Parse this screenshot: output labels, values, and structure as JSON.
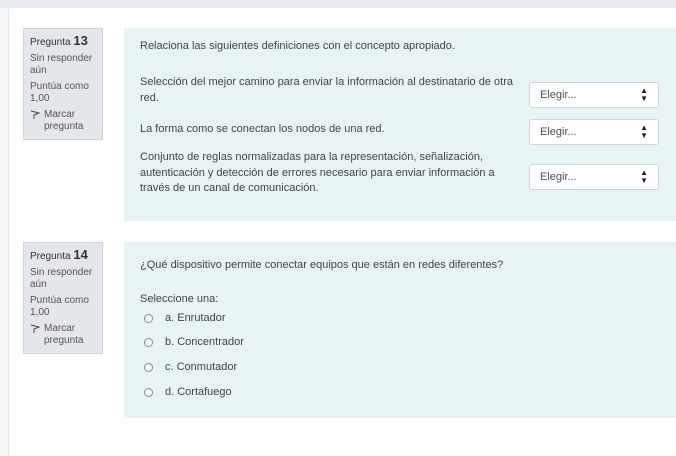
{
  "q13": {
    "label": "Pregunta",
    "number": "13",
    "status": "Sin responder aún",
    "grade": "Puntúa como 1,00",
    "flag": "Marcar pregunta",
    "prompt": "Relaciona las siguientes definiciones con el concepto apropiado.",
    "rows": [
      {
        "text": "Selección del mejor camino para enviar la información al destinatario de otra red.",
        "selected": "Elegir..."
      },
      {
        "text": "La forma como se conectan los nodos de una red.",
        "selected": "Elegir..."
      },
      {
        "text": "Conjunto de reglas normalizadas para la representación, señalización, autenticación y detección de errores necesario para enviar información a través de un canal de comunicación.",
        "selected": "Elegir..."
      }
    ]
  },
  "q14": {
    "label": "Pregunta",
    "number": "14",
    "status": "Sin responder aún",
    "grade": "Puntúa como 1,00",
    "flag": "Marcar pregunta",
    "prompt": "¿Qué dispositivo permite conectar equipos que están en redes diferentes?",
    "select_one": "Seleccione una:",
    "options": [
      "a. Enrutador",
      "b. Concentrador",
      "c. Conmutador",
      "d. Cortafuego"
    ]
  },
  "icons": {
    "flag": "flag-icon",
    "caret": "select-caret-icon"
  }
}
